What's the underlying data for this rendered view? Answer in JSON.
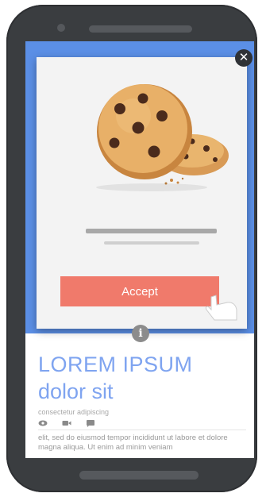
{
  "modal": {
    "accept_label": "Accept",
    "close_icon": "close-icon",
    "info_icon": "info-icon"
  },
  "page": {
    "heading": "LOREM IPSUM",
    "subheading": "dolor sit",
    "tagline": "consectetur adipiscing",
    "meta_icons": [
      "eye-icon",
      "video-icon",
      "chat-icon"
    ],
    "body": "elit, sed do eiusmod tempor incididunt ut labore et dolore magna aliqua. Ut enim ad minim veniam"
  },
  "colors": {
    "accent_blue": "#5b8fe6",
    "heading_blue": "#7fa4f0",
    "accept_button": "#f07a6b",
    "phone_body": "#3a3d40"
  }
}
